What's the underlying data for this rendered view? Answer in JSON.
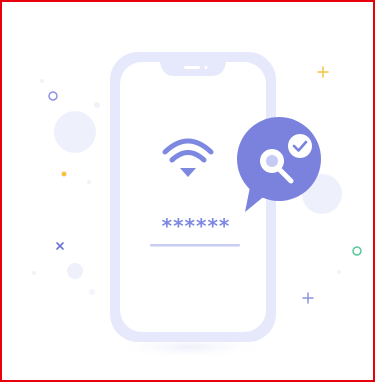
{
  "illustration": {
    "password_mask": "******",
    "icons": [
      "wifi-icon",
      "magnifier-icon",
      "checkmark-icon"
    ],
    "colors": {
      "border": "#e8000c",
      "phone_body": "#e6e9fc",
      "phone_screen": "#ffffff",
      "accent": "#7d88e0",
      "badge": "#7a82dd",
      "sparkle_yellow": "#f5c242",
      "sparkle_green": "#57c79a"
    }
  }
}
